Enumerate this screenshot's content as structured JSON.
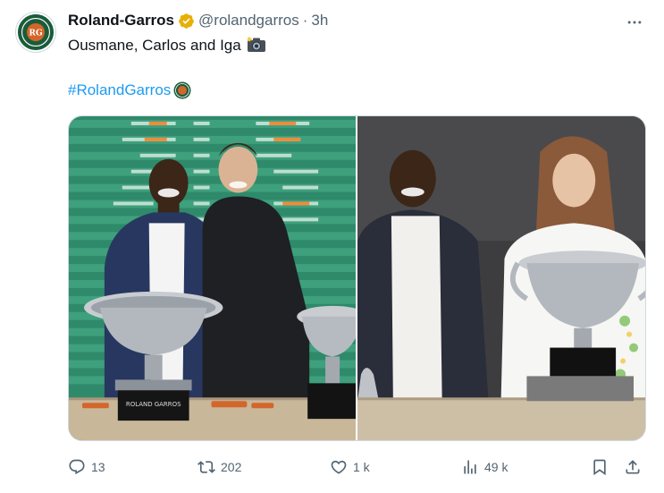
{
  "author": {
    "name": "Roland-Garros",
    "handle": "@rolandgarros",
    "separator": "·",
    "time": "3h",
    "avatar_icon": "roland-garros-logo",
    "verified_color": "#e8b007"
  },
  "tweet": {
    "text": "Ousmane, Carlos and Iga",
    "text_emoji": "camera-flash-icon",
    "hashtag": "#RolandGarros",
    "hashtag_emoji": "roland-garros-logo",
    "link_color": "#1d9bf0"
  },
  "media": {
    "images": [
      {
        "name": "photo-dembele-alcaraz",
        "trophy_plaque": "ROLAND GARROS"
      },
      {
        "name": "photo-dembele-swiatek"
      }
    ]
  },
  "actions": {
    "replies": "13",
    "retweets": "202",
    "likes": "1 k",
    "views": "49 k"
  },
  "colors": {
    "text_secondary": "#536471",
    "brand_green": "#1a5c3a",
    "clay_orange": "#d3662b"
  }
}
